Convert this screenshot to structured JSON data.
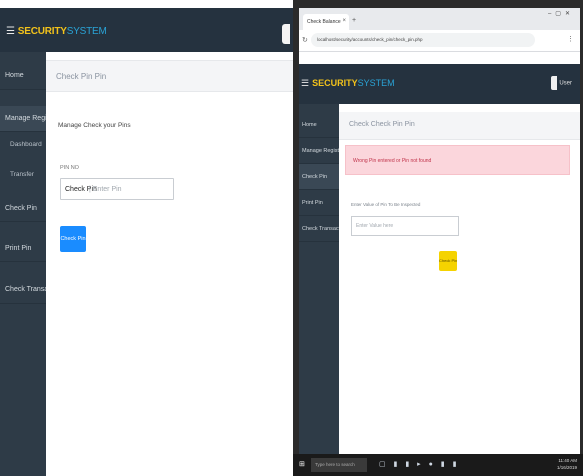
{
  "left": {
    "brand": {
      "menu_icon": "menu-icon",
      "part1": "SECURITY",
      "part2": "SYSTEM"
    },
    "user_icon": "user-icon",
    "sidebar": {
      "items": [
        {
          "label": "Home"
        },
        {
          "label": "Manage Registrations"
        },
        {
          "label": "Dashboard"
        },
        {
          "label": "Transfer"
        },
        {
          "label": "Check Pin"
        },
        {
          "label": "Print Pin"
        },
        {
          "label": "Check Transaction"
        }
      ]
    },
    "page_title": "Check Pin Pin",
    "message": "Manage Check your Pins",
    "field_label": "PIN NO",
    "input_value": "Check Pin",
    "input_placeholder": "| Enter Pin",
    "button_label": "Check Pin"
  },
  "right": {
    "tab_label": "Check Balance",
    "url": "localhost/security/accounts/check_pin/check_pin.php",
    "brand": {
      "part1": "SECURITY",
      "part2": "SYSTEM"
    },
    "user_label": "User",
    "sidebar": {
      "items": [
        {
          "label": "Home"
        },
        {
          "label": "Manage Registrations"
        },
        {
          "label": "Check Pin"
        },
        {
          "label": "Print Pin"
        },
        {
          "label": "Check Transaction"
        }
      ]
    },
    "page_title": "Check Check Pin Pin",
    "alert": "Wrong Pin entered or Pin not found",
    "field_label": "Enter Value of Pin To Be Inspected",
    "input_placeholder": "Enter Value here",
    "button_label": "Check Pin",
    "taskbar": {
      "search": "Type here to search",
      "time": "11:40 AM",
      "date": "1/16/2019"
    }
  },
  "colors": {
    "nav_dark": "#25323f",
    "sidebar": "#2e3b47",
    "brand_yellow": "#f2c21b",
    "brand_blue": "#2aa3d6",
    "primary_button": "#1a8cff",
    "warning_button": "#f5d300",
    "alert_bg": "#fbd6dc",
    "alert_text": "#c0334a"
  }
}
